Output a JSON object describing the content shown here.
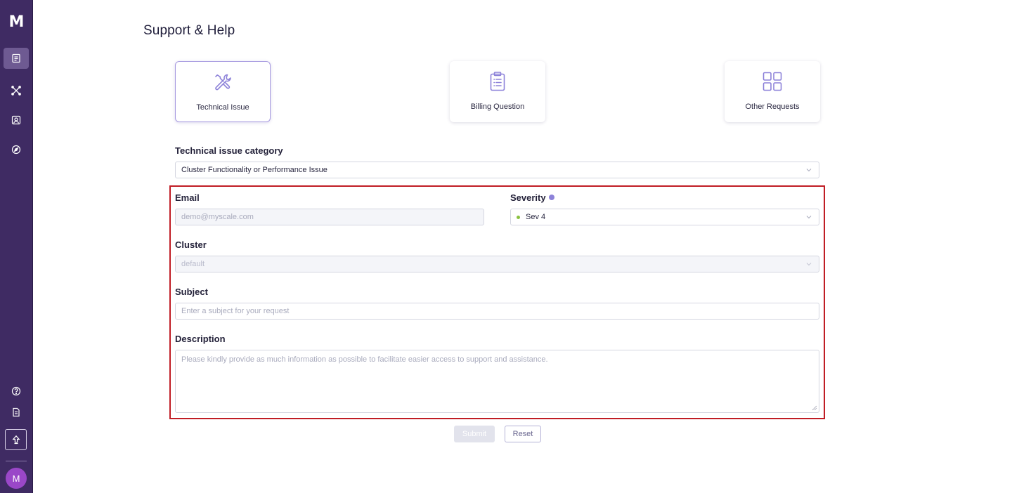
{
  "sidebar": {
    "logo": "M",
    "items": [
      {
        "icon": "dashboard-icon",
        "active": true
      },
      {
        "icon": "connect-icon",
        "active": false
      },
      {
        "icon": "contacts-icon",
        "active": false
      },
      {
        "icon": "compass-icon",
        "active": false
      }
    ],
    "bottom_items": [
      {
        "icon": "help-circle-icon"
      },
      {
        "icon": "document-icon"
      },
      {
        "icon": "upgrade-icon"
      }
    ],
    "avatar_initial": "M"
  },
  "page": {
    "title": "Support & Help"
  },
  "request_types": [
    {
      "label": "Technical Issue",
      "icon": "tools-icon",
      "selected": true
    },
    {
      "label": "Billing Question",
      "icon": "clipboard-icon",
      "selected": false
    },
    {
      "label": "Other Requests",
      "icon": "grid-icon",
      "selected": false
    }
  ],
  "form": {
    "category": {
      "label": "Technical issue category",
      "value": "Cluster Functionality or Performance Issue"
    },
    "email": {
      "label": "Email",
      "placeholder": "demo@myscale.com"
    },
    "severity": {
      "label": "Severity",
      "value": "Sev 4",
      "status_color": "#8ac13f"
    },
    "cluster": {
      "label": "Cluster",
      "value": "default"
    },
    "subject": {
      "label": "Subject",
      "placeholder": "Enter a subject for your request"
    },
    "description": {
      "label": "Description",
      "placeholder": "Please kindly provide as much information as possible to facilitate easier access to support and assistance."
    },
    "submit_label": "Submit",
    "reset_label": "Reset"
  },
  "colors": {
    "sidebar_bg": "#3f2b63",
    "accent": "#8d82d9",
    "highlight": "#c01d25"
  }
}
